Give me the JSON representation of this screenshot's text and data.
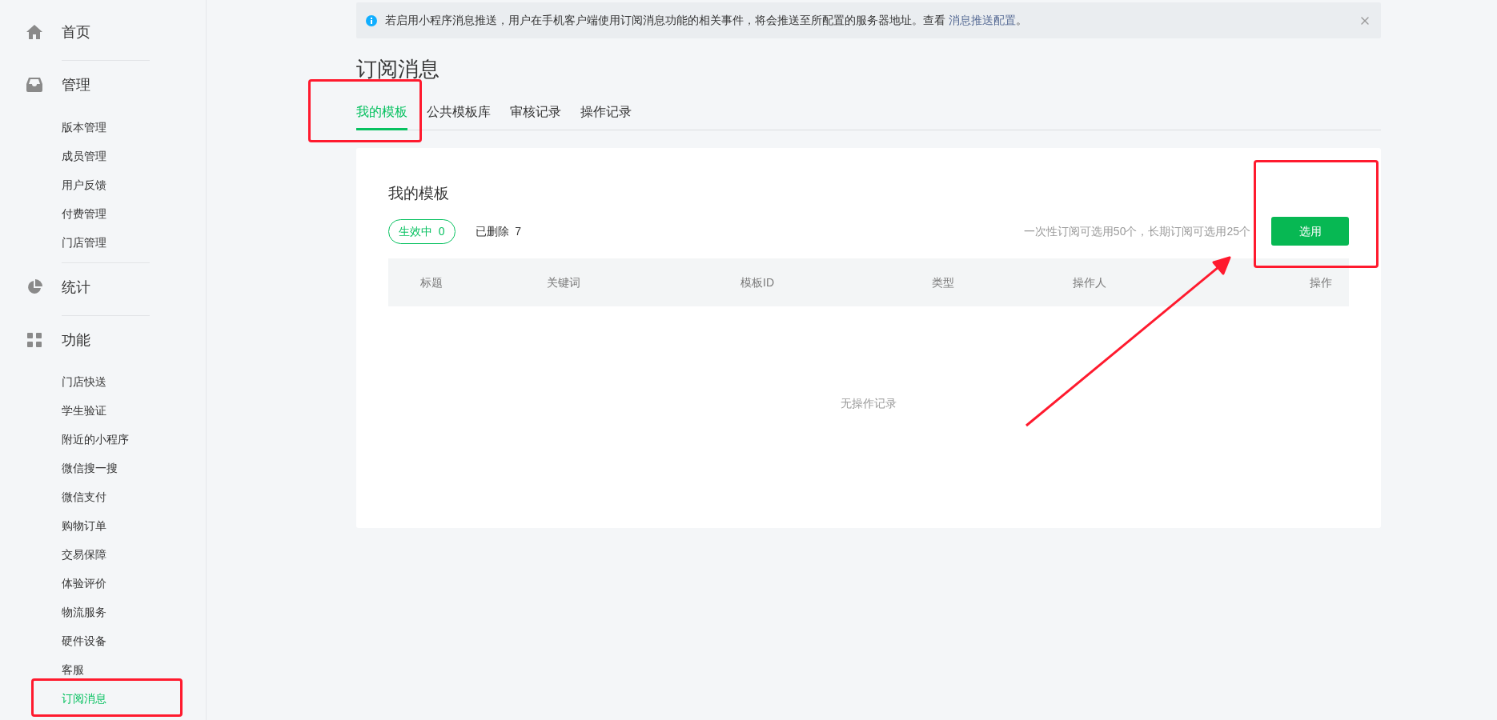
{
  "sidebar": {
    "sections": [
      {
        "label": "首页"
      },
      {
        "label": "管理",
        "items": [
          {
            "label": "版本管理",
            "selected": false
          },
          {
            "label": "成员管理",
            "selected": false
          },
          {
            "label": "用户反馈",
            "selected": false
          },
          {
            "label": "付费管理",
            "selected": false
          },
          {
            "label": "门店管理",
            "selected": false
          }
        ]
      },
      {
        "label": "统计"
      },
      {
        "label": "功能",
        "items": [
          {
            "label": "门店快送",
            "selected": false
          },
          {
            "label": "学生验证",
            "selected": false
          },
          {
            "label": "附近的小程序",
            "selected": false
          },
          {
            "label": "微信搜一搜",
            "selected": false
          },
          {
            "label": "微信支付",
            "selected": false
          },
          {
            "label": "购物订单",
            "selected": false
          },
          {
            "label": "交易保障",
            "selected": false
          },
          {
            "label": "体验评价",
            "selected": false
          },
          {
            "label": "物流服务",
            "selected": false
          },
          {
            "label": "硬件设备",
            "selected": false
          },
          {
            "label": "客服",
            "selected": false
          },
          {
            "label": "订阅消息",
            "selected": true
          }
        ]
      }
    ]
  },
  "notice": {
    "text": "若启用小程序消息推送，用户在手机客户端使用订阅消息功能的相关事件，将会推送至所配置的服务器地址。查看",
    "link": "消息推送配置",
    "suffix": "。"
  },
  "page_title": "订阅消息",
  "tabs": [
    {
      "label": "我的模板",
      "selected": true
    },
    {
      "label": "公共模板库",
      "selected": false
    },
    {
      "label": "审核记录",
      "selected": false
    },
    {
      "label": "操作记录",
      "selected": false
    }
  ],
  "card": {
    "title": "我的模板",
    "filters": [
      {
        "label": "生效中",
        "count": "0",
        "selected": true
      },
      {
        "label": "已删除",
        "count": "7",
        "selected": false
      }
    ],
    "hint": "一次性订阅可选用50个，长期订阅可选用25个",
    "button": "选用",
    "table": {
      "columns": [
        "标题",
        "关键词",
        "模板ID",
        "类型",
        "操作人",
        "操作"
      ],
      "empty_text": "无操作记录"
    }
  }
}
